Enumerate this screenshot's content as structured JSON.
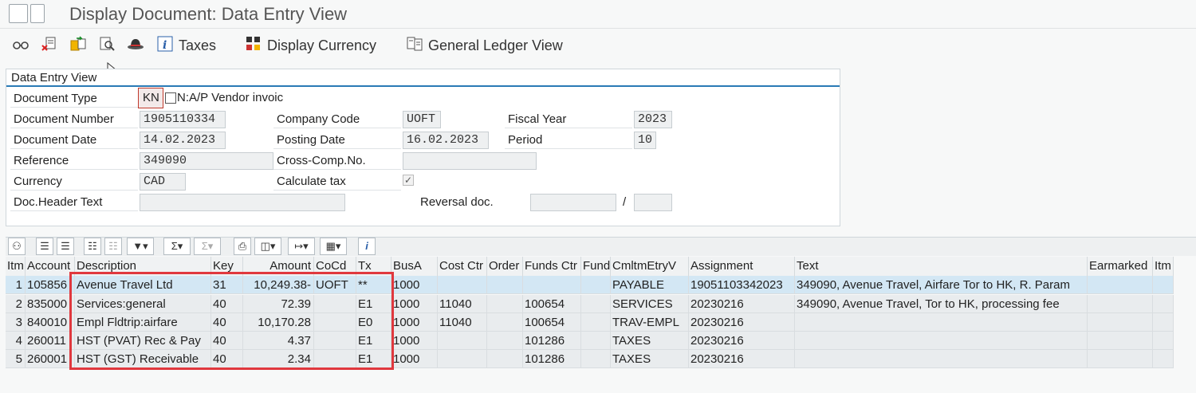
{
  "window": {
    "title": "Display Document: Data Entry View"
  },
  "toolbar": {
    "taxes": "Taxes",
    "display_currency": "Display Currency",
    "gl_view": "General Ledger View"
  },
  "group": {
    "title": "Data Entry View"
  },
  "header_fields": {
    "doc_type_label": "Document Type",
    "doc_type_value": "KN",
    "doc_type_desc": "N:A/P Vendor invoic",
    "doc_number_label": "Document Number",
    "doc_number_value": "1905110334",
    "company_code_label": "Company Code",
    "company_code_value": "UOFT",
    "fiscal_year_label": "Fiscal Year",
    "fiscal_year_value": "2023",
    "doc_date_label": "Document Date",
    "doc_date_value": "14.02.2023",
    "posting_date_label": "Posting Date",
    "posting_date_value": "16.02.2023",
    "period_label": "Period",
    "period_value": "10",
    "reference_label": "Reference",
    "reference_value": "349090",
    "cross_comp_label": "Cross-Comp.No.",
    "cross_comp_value": "",
    "currency_label": "Currency",
    "currency_value": "CAD",
    "calc_tax_label": "Calculate tax",
    "calc_tax_checked": "✓",
    "doc_header_text_label": "Doc.Header Text",
    "doc_header_text_value": "",
    "reversal_doc_label": "Reversal doc.",
    "reversal_doc_value": "",
    "reversal_sep": "/",
    "reversal_year_value": ""
  },
  "grid": {
    "columns": [
      "Itm",
      "Account",
      "Description",
      "Key",
      "Amount",
      "CoCd",
      "Tx",
      "BusA",
      "Cost Ctr",
      "Order",
      "Funds Ctr",
      "Fund",
      "CmltmEtryV",
      "Assignment",
      "Text",
      "Earmarked",
      "Itm"
    ],
    "rows": [
      {
        "itm": "1",
        "account": "105856",
        "description": "Avenue Travel Ltd",
        "key": "31",
        "amount": "10,249.38-",
        "cocd": "UOFT",
        "tx": "**",
        "busa": "1000",
        "costctr": "",
        "order": "",
        "fundsctr": "",
        "fund": "",
        "cmltm": "PAYABLE",
        "assignment": "19051103342023",
        "text": "349090, Avenue Travel, Airfare Tor to HK, R. Param",
        "earmarked": "",
        "itm2": ""
      },
      {
        "itm": "2",
        "account": "835000",
        "description": "Services:general",
        "key": "40",
        "amount": "72.39",
        "cocd": "",
        "tx": "E1",
        "busa": "1000",
        "costctr": "11040",
        "order": "",
        "fundsctr": "100654",
        "fund": "",
        "cmltm": "SERVICES",
        "assignment": "20230216",
        "text": "349090, Avenue Travel, Tor to HK, processing fee",
        "earmarked": "",
        "itm2": ""
      },
      {
        "itm": "3",
        "account": "840010",
        "description": "Empl Fldtrip:airfare",
        "key": "40",
        "amount": "10,170.28",
        "cocd": "",
        "tx": "E0",
        "busa": "1000",
        "costctr": "11040",
        "order": "",
        "fundsctr": "100654",
        "fund": "",
        "cmltm": "TRAV-EMPL",
        "assignment": "20230216",
        "text": "",
        "earmarked": "",
        "itm2": ""
      },
      {
        "itm": "4",
        "account": "260011",
        "description": "HST (PVAT) Rec & Pay",
        "key": "40",
        "amount": "4.37",
        "cocd": "",
        "tx": "E1",
        "busa": "1000",
        "costctr": "",
        "order": "",
        "fundsctr": "101286",
        "fund": "",
        "cmltm": "TAXES",
        "assignment": "20230216",
        "text": "",
        "earmarked": "",
        "itm2": ""
      },
      {
        "itm": "5",
        "account": "260001",
        "description": "HST (GST) Receivable",
        "key": "40",
        "amount": "2.34",
        "cocd": "",
        "tx": "E1",
        "busa": "1000",
        "costctr": "",
        "order": "",
        "fundsctr": "101286",
        "fund": "",
        "cmltm": "TAXES",
        "assignment": "20230216",
        "text": "",
        "earmarked": "",
        "itm2": ""
      }
    ]
  },
  "colors": {
    "accent": "#2a7ab5",
    "selected_row": "#d3e7f4",
    "highlight_box": "#e0383e"
  },
  "icons": [
    "menu-icon",
    "other-document-icon",
    "delete-icon",
    "transfer-icon",
    "search-icon",
    "hat-icon",
    "info-icon",
    "display-currency-icon",
    "ledger-icon"
  ]
}
